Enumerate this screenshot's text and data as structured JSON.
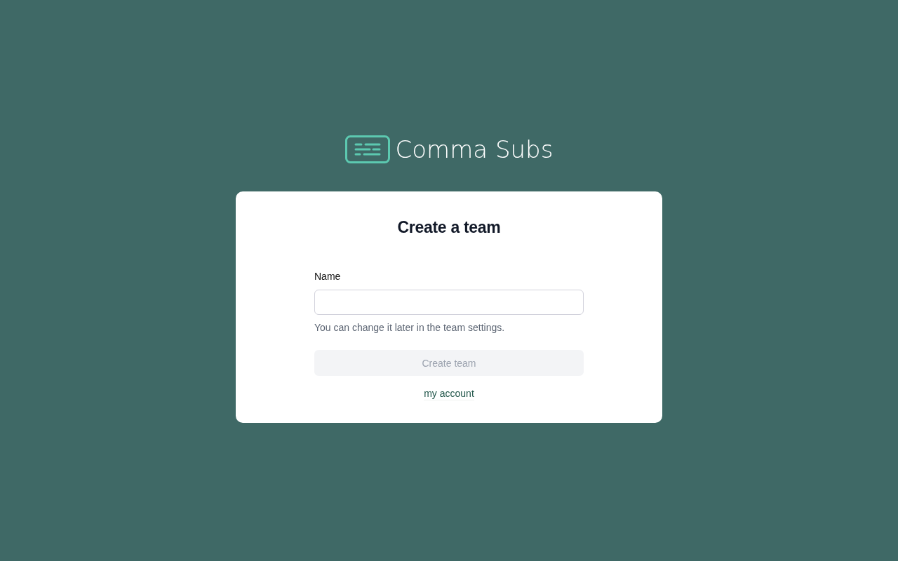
{
  "brand": {
    "name": "Comma Subs"
  },
  "card": {
    "title": "Create a team",
    "field": {
      "label": "Name",
      "hint": "You can change it later in the team settings."
    },
    "submit": {
      "label": "Create team",
      "disabled": true
    },
    "link": {
      "label": "my account"
    }
  }
}
